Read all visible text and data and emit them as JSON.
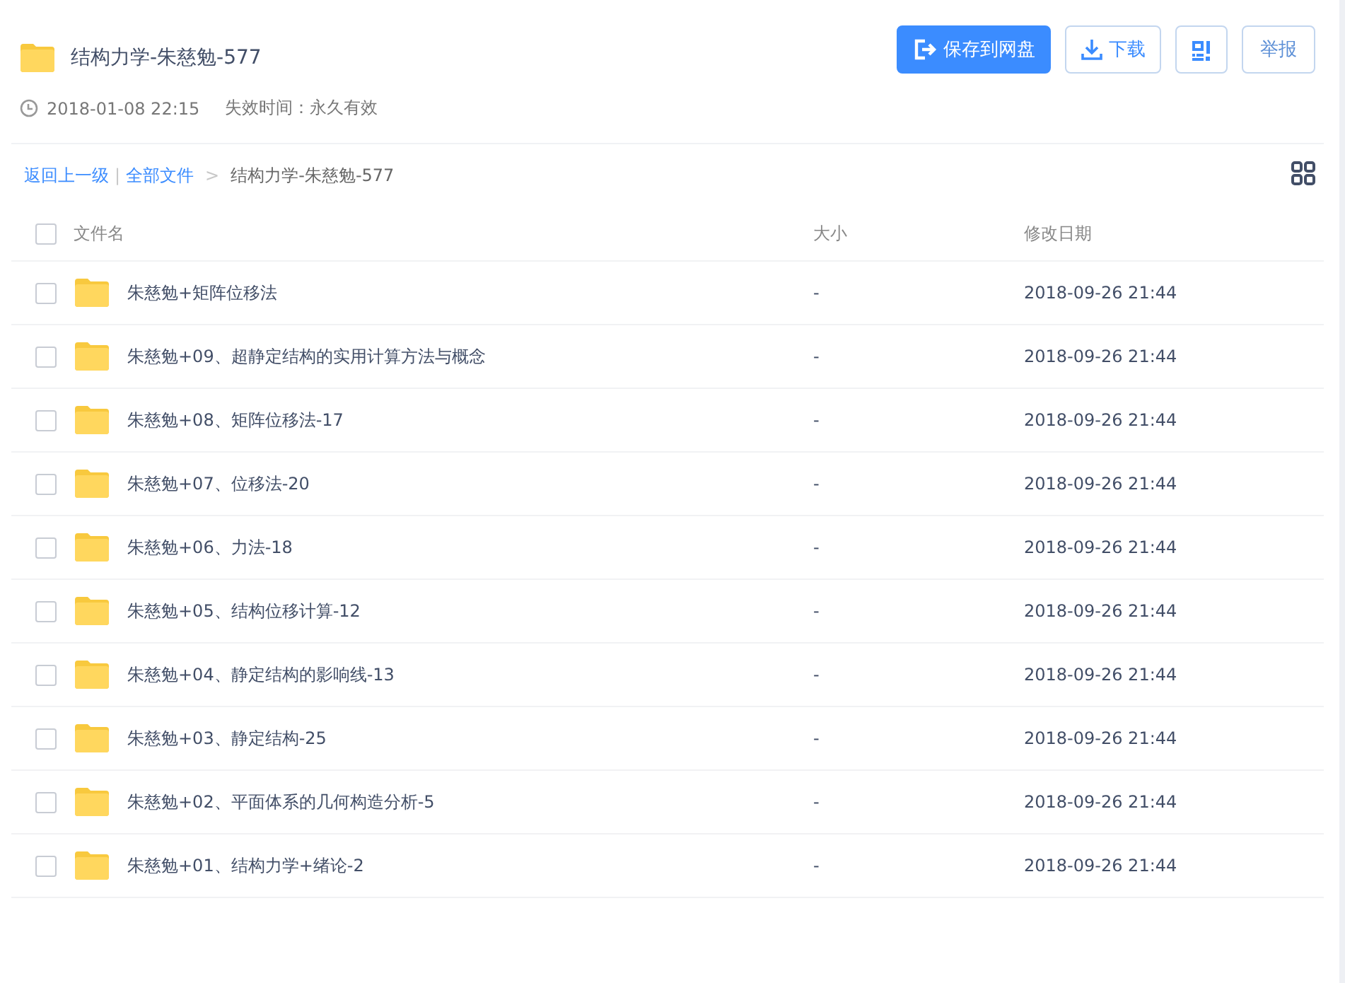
{
  "share": {
    "title": "结构力学-朱慈勉-577",
    "created": "2018-01-08 22:15",
    "expiry": "失效时间：永久有效"
  },
  "actions": [
    {
      "kind": "save",
      "label": "保存到网盘"
    },
    {
      "kind": "download",
      "label": "下载"
    },
    {
      "kind": "qrcode"
    },
    {
      "kind": "report",
      "label": "举报"
    }
  ],
  "breadcrumb": {
    "back": "返回上一级",
    "separator": "|",
    "root": "全部文件",
    "arrow": ">",
    "current": "结构力学-朱慈勉-577"
  },
  "table": {
    "select_all_checked": false,
    "columns": [
      "文件名",
      "大小",
      "修改日期"
    ],
    "rows": [
      {
        "name": "朱慈勉+矩阵位移法",
        "size": "-",
        "date": "2018-09-26 21:44",
        "checked": false
      },
      {
        "name": "朱慈勉+09、超静定结构的实用计算方法与概念",
        "size": "-",
        "date": "2018-09-26 21:44",
        "checked": false
      },
      {
        "name": "朱慈勉+08、矩阵位移法-17",
        "size": "-",
        "date": "2018-09-26 21:44",
        "checked": false
      },
      {
        "name": "朱慈勉+07、位移法-20",
        "size": "-",
        "date": "2018-09-26 21:44",
        "checked": false
      },
      {
        "name": "朱慈勉+06、力法-18",
        "size": "-",
        "date": "2018-09-26 21:44",
        "checked": false
      },
      {
        "name": "朱慈勉+05、结构位移计算-12",
        "size": "-",
        "date": "2018-09-26 21:44",
        "checked": false
      },
      {
        "name": "朱慈勉+04、静定结构的影响线-13",
        "size": "-",
        "date": "2018-09-26 21:44",
        "checked": false
      },
      {
        "name": "朱慈勉+03、静定结构-25",
        "size": "-",
        "date": "2018-09-26 21:44",
        "checked": false
      },
      {
        "name": "朱慈勉+02、平面体系的几何构造分析-5",
        "size": "-",
        "date": "2018-09-26 21:44",
        "checked": false
      },
      {
        "name": "朱慈勉+01、结构力学+绪论-2",
        "size": "-",
        "date": "2018-09-26 21:44",
        "checked": false
      }
    ]
  }
}
